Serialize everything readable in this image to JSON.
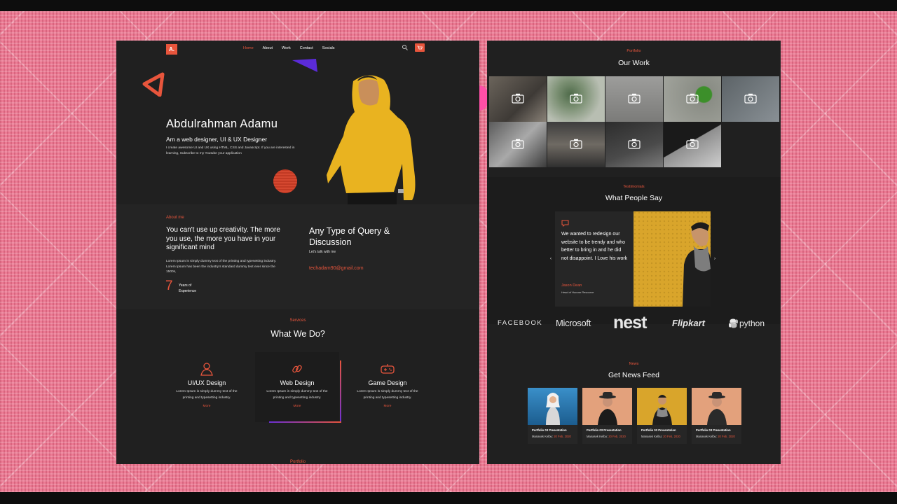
{
  "colors": {
    "accent": "#e8553c",
    "page_bg": "#202020",
    "fabric": "#ec7b94",
    "purple": "#6b2fd6"
  },
  "left": {
    "logo": "A.",
    "nav": [
      "Home",
      "About",
      "Work",
      "Contact",
      "Socials"
    ],
    "nav_active": "Home",
    "hero": {
      "name": "Abdulrahman Adamu",
      "role": "Am a web designer, UI & UX Designer",
      "description": "I create awesome UI and UX using HTML, CSS and Javascript. If you are interested in learning, Subscribe to my Youtube your application"
    },
    "about": {
      "label": "About me",
      "heading": "You can't use up creativity. The more you use, the more you have in your significant mind",
      "text": "Lorem Ipsum is simply dummy text of the printing and typesetting industry. Lorem Ipsum has been the industry's standard dummy text ever since the 1500s,",
      "years_number": "7",
      "years_label": "Years of Experience"
    },
    "query": {
      "heading": "Any Type of Query & Discussion",
      "sub": "Let's talk with me",
      "email": "techadam90@gmail.com"
    },
    "services": {
      "label": "Services",
      "title": "What We Do?",
      "items": [
        {
          "name": "UI/UX Design",
          "desc": "Lorem Ipsum is simply dummy text of the printing and typesetting industry.",
          "more": "More",
          "icon": "user-icon"
        },
        {
          "name": "Web Design",
          "desc": "Lorem Ipsum is simply dummy text of the printing and typesetting industry.",
          "more": "More",
          "icon": "link-icon"
        },
        {
          "name": "Game Design",
          "desc": "Lorem Ipsum is simply dummy text of the printing and typesetting industry.",
          "more": "More",
          "icon": "gamepad-icon"
        }
      ]
    },
    "portfolio_peek": "Portfolio"
  },
  "right": {
    "portfolio": {
      "label": "Portfolio",
      "title": "Our Work",
      "tile_icon": "camera-icon"
    },
    "testimonials": {
      "label": "Testimonials",
      "title": "What People Say",
      "quote": "We wanted to redesign our website to be trendy and who better to bring in and he did not disappoint. I Love his work",
      "author": "Jason Dean",
      "role": "Head of Human Resource",
      "prev": "‹",
      "next": "›"
    },
    "brands": [
      "FACEBOOK",
      "Microsoft",
      "nest",
      "Flipkart",
      "python"
    ],
    "news": {
      "label": "News",
      "title": "Get News Feed",
      "items": [
        {
          "title": "Portfolio 03 Presentation",
          "author": "Manasek Kelbu:",
          "date": "20 Feb, 2020"
        },
        {
          "title": "Portfolio 03 Presentation",
          "author": "Manasek Kelbu:",
          "date": "20 Feb, 2020"
        },
        {
          "title": "Portfolio 03 Presentation",
          "author": "Manasek Kelbu:",
          "date": "20 Feb, 2020"
        },
        {
          "title": "Portfolio 03 Presentation",
          "author": "Manasek Kelbu:",
          "date": "20 Feb, 2020"
        }
      ]
    }
  }
}
